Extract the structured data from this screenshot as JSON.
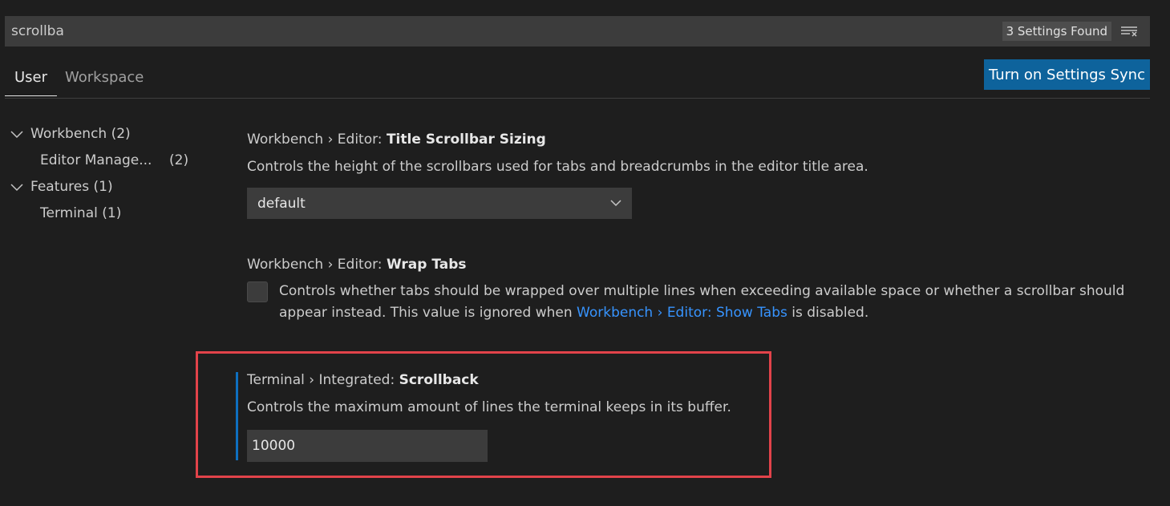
{
  "search": {
    "value": "scrollba",
    "results_badge": "3 Settings Found",
    "filter_icon": "clear-filter-icon"
  },
  "tabs": {
    "user": "User",
    "workspace": "Workspace"
  },
  "sync_button": "Turn on Settings Sync",
  "toc": [
    {
      "label": "Workbench (2)",
      "expanded": true
    },
    {
      "label": "Editor Manage...",
      "count": "(2)"
    },
    {
      "label": "Features (1)",
      "expanded": true
    },
    {
      "label": "Terminal (1)"
    }
  ],
  "settings": {
    "title_scrollbar": {
      "category": "Workbench › Editor: ",
      "key": "Title Scrollbar Sizing",
      "description": "Controls the height of the scrollbars used for tabs and breadcrumbs in the editor title area.",
      "value": "default"
    },
    "wrap_tabs": {
      "category": "Workbench › Editor: ",
      "key": "Wrap Tabs",
      "description_before": "Controls whether tabs should be wrapped over multiple lines when exceeding available space or whether a scrollbar should appear instead. This value is ignored when ",
      "link": "Workbench › Editor: Show Tabs",
      "description_after": " is disabled.",
      "checked": false
    },
    "scrollback": {
      "category": "Terminal › Integrated: ",
      "key": "Scrollback",
      "description": "Controls the maximum amount of lines the terminal keeps in its buffer.",
      "value": "10000"
    }
  },
  "colors": {
    "background": "#1e1e1e",
    "input": "#3c3c3c",
    "accent_button": "#0e639c",
    "link": "#3794ff",
    "focus_bar": "#0e70c0",
    "highlight": "#e2434a"
  }
}
